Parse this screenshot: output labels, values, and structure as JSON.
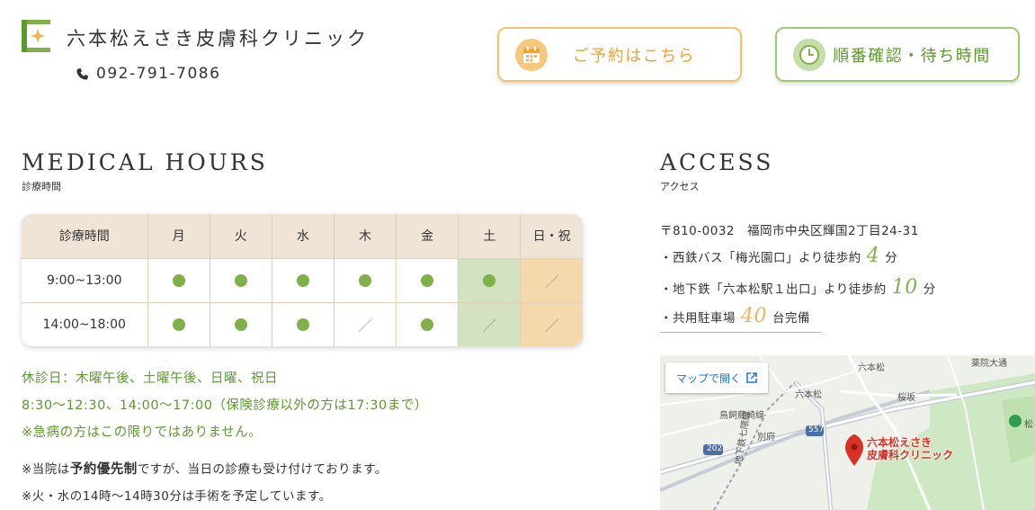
{
  "header": {
    "clinic_name": "六本松えさき皮膚科クリニック",
    "phone": "092-791-7086",
    "reserve_label": "ご予約はこちら",
    "queue_label": "順番確認・待ち時間"
  },
  "hours": {
    "title": "MEDICAL HOURS",
    "subtitle": "診療時間",
    "headers": [
      "診療時間",
      "月",
      "火",
      "水",
      "木",
      "金",
      "土",
      "日・祝"
    ],
    "rows": [
      {
        "time": "9:00~13:00",
        "marks": [
          "open",
          "open",
          "open",
          "open",
          "open",
          "open",
          "closed"
        ]
      },
      {
        "time": "14:00~18:00",
        "marks": [
          "open",
          "open",
          "open",
          "closed",
          "open",
          "closed",
          "closed"
        ]
      }
    ],
    "closed_days": "休診日：木曜午後、土曜午後、日曜、祝日",
    "times_note": "8:30〜12:30、14:00〜17:00（保険診療以外の方は17:30まで）",
    "emergency_note": "※急病の方はこの限りではありません。",
    "priority_pre": "※当院は",
    "priority_bold": "予約優先制",
    "priority_post": "ですが、当日の診療も受け付けております。",
    "surgery_note": "※火・水の14時〜14時30分は手術を予定しています。"
  },
  "access": {
    "title": "ACCESS",
    "subtitle": "アクセス",
    "address": "〒810-0032　福岡市中央区輝国2丁目24-31",
    "bus_pre": "・西鉄バス「梅光園口」より徒歩約",
    "bus_min": "4",
    "bus_unit": "分",
    "subway_pre": "・地下鉄「六本松駅１出口」より徒歩約",
    "subway_min": "10",
    "subway_unit": "分",
    "parking_pre": "・共用駐車場",
    "parking_num": "40",
    "parking_post": "台完備"
  },
  "map": {
    "open_label": "マップで開く",
    "pin_label_1": "六本松えさき",
    "pin_label_2": "皮膚科クリニック",
    "labels": {
      "rokuhonmatsu_top": "六本松",
      "rokuhonmatsu_station": "六本松",
      "yakuin": "薬院大通",
      "sakurazaka": "桜坂",
      "line": "鳥飼藤崎線",
      "betsufu": "別府",
      "route_557": "557",
      "route_202": "202",
      "subway_line": "地下鉄七隈線",
      "matsu": "松"
    }
  },
  "colors": {
    "green": "#7fb04a",
    "orange": "#f0a13a",
    "sat_bg": "#d3e2c1",
    "sun_bg": "#f3d9ab",
    "header_bg": "#efe4d6"
  }
}
